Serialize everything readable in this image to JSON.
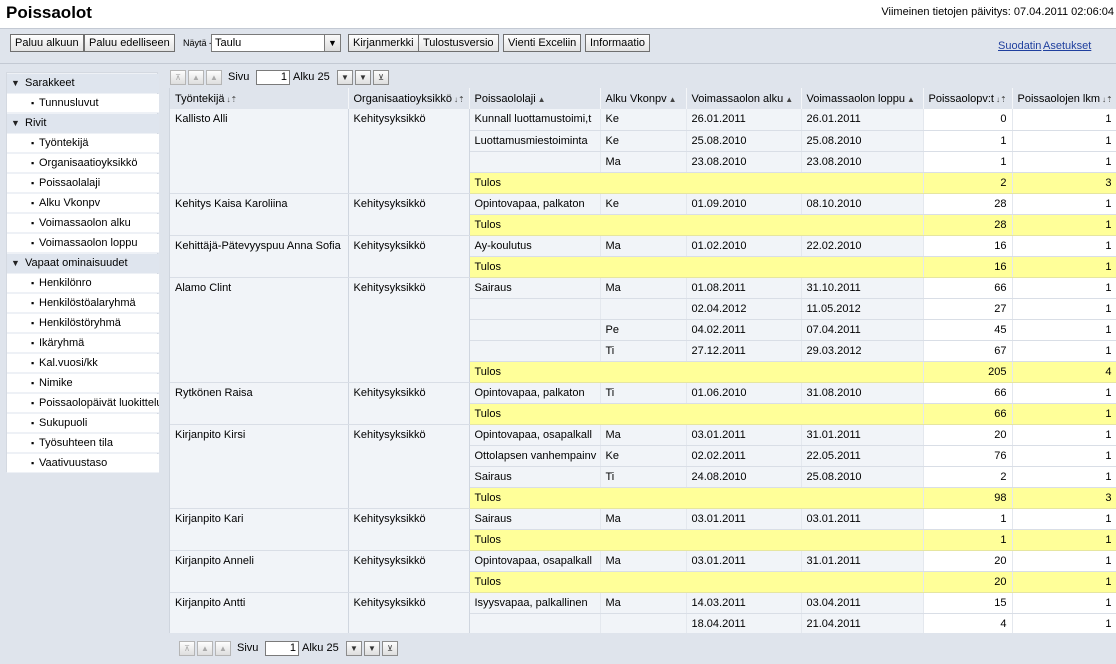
{
  "header": {
    "title": "Poissaolot",
    "last_update": "Viimeinen tietojen päivitys: 07.04.2011 02:06:04"
  },
  "toolbar": {
    "back_start": "Paluu alkuun",
    "back_prev": "Paluu edelliseen",
    "show_label": "Näytä -",
    "show_value": "Taulu",
    "bookmark": "Kirjanmerkki",
    "print": "Tulostusversio",
    "export": "Vienti Exceliin",
    "info": "Informaatio",
    "filters": "Suodatin",
    "settings": "Asetukset"
  },
  "sidebar": {
    "sections": [
      {
        "label": "Sarakkeet",
        "items": [
          "Tunnusluvut"
        ]
      },
      {
        "label": "Rivit",
        "items": [
          "Työntekijä",
          "Organisaatioyksikkö",
          "Poissaolalaji",
          "Alku Vkonpv",
          "Voimassaolon alku",
          "Voimassaolon loppu"
        ]
      },
      {
        "label": "Vapaat ominaisuudet",
        "items": [
          "Henkilönro",
          "Henkilöstöalaryhmä",
          "Henkilöstöryhmä",
          "Ikäryhmä",
          "Kal.vuosi/kk",
          "Nimike",
          "Poissaolopäivät luokittelu",
          "Sukupuoli",
          "Työsuhteen tila",
          "Vaativuustaso"
        ]
      }
    ]
  },
  "pager": {
    "page_label": "Sivu",
    "page_value": "1",
    "start_label": "Alku 25"
  },
  "table": {
    "columns": [
      "Työntekijä",
      "Organisaatioyksikkö",
      "Poissaololaji",
      "Alku Vkonpv",
      "Voimassaolon alku",
      "Voimassaolon loppu",
      "Poissaolopv:t",
      "Poissaolojen lkm"
    ],
    "total_label": "Tulos",
    "groups": [
      {
        "employee": "Kallisto Alli",
        "org": "Kehitysyksikkö",
        "rows": [
          {
            "type": "Kunnall luottamustoimi,t",
            "day": "Ke",
            "start": "26.01.2011",
            "end": "26.01.2011",
            "days": "0",
            "count": "1"
          },
          {
            "type": "Luottamusmiestoiminta",
            "day": "Ke",
            "start": "25.08.2010",
            "end": "25.08.2010",
            "days": "1",
            "count": "1"
          },
          {
            "type": "",
            "day": "Ma",
            "start": "23.08.2010",
            "end": "23.08.2010",
            "days": "1",
            "count": "1"
          }
        ],
        "total": {
          "days": "2",
          "count": "3"
        }
      },
      {
        "employee": "Kehitys Kaisa Karoliina",
        "org": "Kehitysyksikkö",
        "rows": [
          {
            "type": "Opintovapaa, palkaton",
            "day": "Ke",
            "start": "01.09.2010",
            "end": "08.10.2010",
            "days": "28",
            "count": "1"
          }
        ],
        "total": {
          "days": "28",
          "count": "1"
        }
      },
      {
        "employee": "Kehittäjä-Pätevyyspuu Anna Sofia",
        "org": "Kehitysyksikkö",
        "rows": [
          {
            "type": "Ay-koulutus",
            "day": "Ma",
            "start": "01.02.2010",
            "end": "22.02.2010",
            "days": "16",
            "count": "1"
          }
        ],
        "total": {
          "days": "16",
          "count": "1"
        }
      },
      {
        "employee": "Alamo Clint",
        "org": "Kehitysyksikkö",
        "rows": [
          {
            "type": "Sairaus",
            "day": "Ma",
            "start": "01.08.2011",
            "end": "31.10.2011",
            "days": "66",
            "count": "1"
          },
          {
            "type": "",
            "day": "",
            "start": "02.04.2012",
            "end": "11.05.2012",
            "days": "27",
            "count": "1"
          },
          {
            "type": "",
            "day": "Pe",
            "start": "04.02.2011",
            "end": "07.04.2011",
            "days": "45",
            "count": "1"
          },
          {
            "type": "",
            "day": "Ti",
            "start": "27.12.2011",
            "end": "29.03.2012",
            "days": "67",
            "count": "1"
          }
        ],
        "total": {
          "days": "205",
          "count": "4"
        }
      },
      {
        "employee": "Rytkönen Raisa",
        "org": "Kehitysyksikkö",
        "rows": [
          {
            "type": "Opintovapaa, palkaton",
            "day": "Ti",
            "start": "01.06.2010",
            "end": "31.08.2010",
            "days": "66",
            "count": "1"
          }
        ],
        "total": {
          "days": "66",
          "count": "1"
        }
      },
      {
        "employee": "Kirjanpito Kirsi",
        "org": "Kehitysyksikkö",
        "rows": [
          {
            "type": "Opintovapaa, osapalkall",
            "day": "Ma",
            "start": "03.01.2011",
            "end": "31.01.2011",
            "days": "20",
            "count": "1"
          },
          {
            "type": "Ottolapsen vanhempainv",
            "day": "Ke",
            "start": "02.02.2011",
            "end": "22.05.2011",
            "days": "76",
            "count": "1"
          },
          {
            "type": "Sairaus",
            "day": "Ti",
            "start": "24.08.2010",
            "end": "25.08.2010",
            "days": "2",
            "count": "1"
          }
        ],
        "total": {
          "days": "98",
          "count": "3"
        }
      },
      {
        "employee": "Kirjanpito Kari",
        "org": "Kehitysyksikkö",
        "rows": [
          {
            "type": "Sairaus",
            "day": "Ma",
            "start": "03.01.2011",
            "end": "03.01.2011",
            "days": "1",
            "count": "1"
          }
        ],
        "total": {
          "days": "1",
          "count": "1"
        }
      },
      {
        "employee": "Kirjanpito Anneli",
        "org": "Kehitysyksikkö",
        "rows": [
          {
            "type": "Opintovapaa, osapalkall",
            "day": "Ma",
            "start": "03.01.2011",
            "end": "31.01.2011",
            "days": "20",
            "count": "1"
          }
        ],
        "total": {
          "days": "20",
          "count": "1"
        }
      },
      {
        "employee": "Kirjanpito Antti",
        "org": "Kehitysyksikkö",
        "rows": [
          {
            "type": "Isyysvapaa, palkallinen",
            "day": "Ma",
            "start": "14.03.2011",
            "end": "03.04.2011",
            "days": "15",
            "count": "1"
          },
          {
            "type": "",
            "day": "",
            "start": "18.04.2011",
            "end": "21.04.2011",
            "days": "4",
            "count": "1"
          }
        ],
        "total": null
      }
    ]
  }
}
